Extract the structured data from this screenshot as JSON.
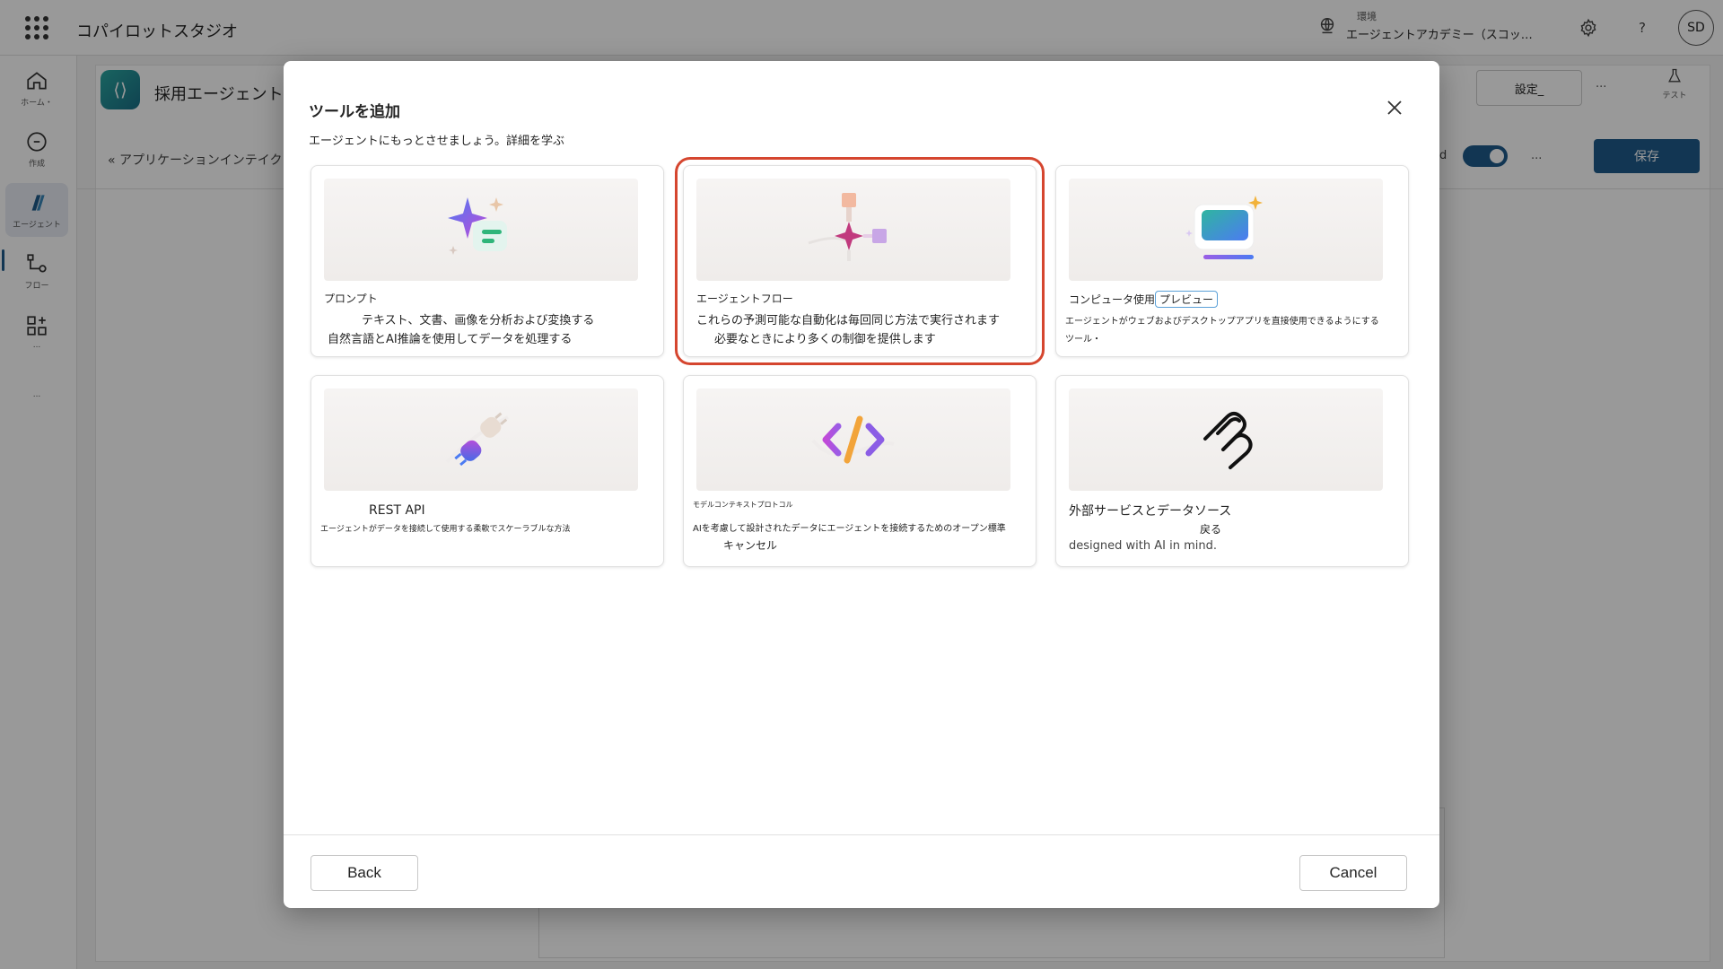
{
  "header": {
    "app_title": "コパイロットスタジオ",
    "env_label": "環境",
    "env_name": "エージェントアカデミー（スコット...",
    "avatar_initials": "SD",
    "help_label": "?"
  },
  "rail": {
    "items": [
      {
        "label": "ホーム・"
      },
      {
        "label": "作成"
      },
      {
        "label": "エージェント"
      },
      {
        "label": "フロー"
      },
      {
        "label": "..."
      },
      {
        "label": "..."
      }
    ]
  },
  "background": {
    "agent_name": "採用エージェント",
    "breadcrumb": "« アプリケーションインテイク",
    "settings_label": "設定_",
    "more_label": "...",
    "test_label": "テスト",
    "toggle_prefix": "d",
    "save_label": "保存"
  },
  "modal": {
    "title": "ツールを追加",
    "subtitle": "エージェントにもっとさせましょう。詳細を学ぶ",
    "tiles": [
      {
        "name": "プロンプト",
        "desc1": "テキスト、文書、画像を分析および変換する",
        "desc2": "自然言語とAI推論を使用してデータを処理する"
      },
      {
        "name": "エージェントフロー",
        "desc1": "これらの予測可能な自動化は毎回同じ方法で実行されます",
        "desc2": "必要なときにより多くの制御を提供します"
      },
      {
        "name": "コンピュータ使用",
        "badge": "プレビュー",
        "desc1": "エージェントがウェブおよびデスクトップアプリを直接使用できるようにする",
        "desc2": "ツール・"
      },
      {
        "name": "REST API",
        "desc1": "エージェントがデータを接続して使用する柔軟でスケーラブルな方法"
      },
      {
        "name": "モデルコンテキストプロトコル",
        "desc1": "AIを考慮して設計されたデータにエージェントを接続するためのオープン標準",
        "desc2": "キャンセル"
      },
      {
        "name": "外部サービスとデータソース",
        "desc1": "戻る",
        "desc2": "designed with AI in mind."
      }
    ],
    "back_label": "Back",
    "cancel_label": "Cancel"
  },
  "colors": {
    "accent": "#1f5b8a",
    "highlight_border": "#d5462f",
    "overlay": "rgba(0,0,0,0.40)"
  },
  "icons": [
    "waffle-icon",
    "environment-icon",
    "gear-icon",
    "help-icon",
    "home-icon",
    "create-icon",
    "agents-icon",
    "flows-icon",
    "tools-icon",
    "close-icon",
    "sparkle-prompt-icon",
    "agent-flow-icon",
    "computer-use-icon",
    "plug-icon",
    "code-icon",
    "mcp-icon",
    "flask-icon"
  ]
}
